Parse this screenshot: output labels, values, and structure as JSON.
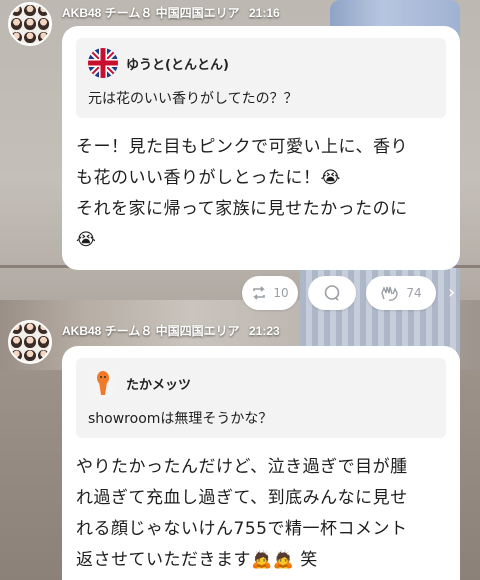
{
  "posts": [
    {
      "author": "AKB48 チーム８ 中国四国エリア",
      "time": "21:16",
      "quote": {
        "name": "ゆうと(とんとん)",
        "text": "元は花のいい香りがしてたの？？",
        "icon": "union-jack-flag-icon"
      },
      "body_lines": [
        "そー！見た目もピンクで可愛い上に、香り",
        "も花のいい香りがしとったに！😭",
        "それを家に帰って家族に見せたかったのに",
        "😭"
      ],
      "actions": {
        "repost_count": "10",
        "like_count": "74"
      }
    },
    {
      "author": "AKB48 チーム８ 中国四国エリア",
      "time": "21:23",
      "quote": {
        "name": "たかメッツ",
        "text": "showroomは無理そうかな？",
        "icon": "orange-figure-icon"
      },
      "body_lines": [
        "やりたかったんだけど、泣き過ぎで目が腫",
        "れ過ぎて充血し過ぎて、到底みんなに見せ",
        "れる顔じゃないけん755で精一杯コメント",
        "返させていただきます🙇🙇 笑"
      ]
    }
  ]
}
